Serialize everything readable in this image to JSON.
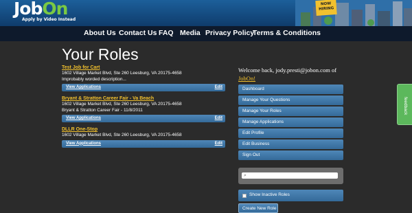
{
  "header": {
    "logo_text_a": "Job",
    "logo_text_b": "On",
    "logo_tagline": "Apply by Video Instead",
    "hiring_badge": "NOW HIRING"
  },
  "nav": {
    "items": [
      "About Us",
      "Contact Us",
      "FAQ",
      "Media",
      "Privacy Policy",
      "Terms & Conditions"
    ]
  },
  "main": {
    "title": "Your Roles",
    "roles": [
      {
        "name": "Test Job for Cart",
        "lines": [
          "1602 Village Market Blvd, Ste 260 Leesburg, VA 20175-4658",
          "Improbably worded description..."
        ],
        "view_label": "View Applications",
        "edit_label": "Edit"
      },
      {
        "name": "Bryant & Stratton Career Fair - Va Beach",
        "lines": [
          "1602 Village Market Blvd, Ste 260 Leesburg, VA 20175-4658",
          "Bryant & Stratton Career Fair - 11/8/2011"
        ],
        "view_label": "View Applications",
        "edit_label": "Edit"
      },
      {
        "name": "DLLR One-Stop",
        "lines": [
          "1602 Village Market Blvd, Ste 260 Leesburg, VA 20175-4658"
        ],
        "view_label": "View Applications",
        "edit_label": "Edit"
      }
    ]
  },
  "sidebar": {
    "welcome_text": "Welcome back, jody.presti@jobon.com of",
    "welcome_link": "JobOn!",
    "menu": [
      "Dashboard",
      "Manage Your Questions",
      "Manage Your Roles",
      "Manage Applications",
      "Edit Profile",
      "Edit Business",
      "Sign Out"
    ],
    "search_placeholder": "",
    "show_inactive_label": "Show Inactive Roles",
    "show_inactive_checked": false,
    "create_label": "Create New Role"
  },
  "feedback": {
    "label": "feedback"
  },
  "colors": {
    "header_blue": "#1c5f9a",
    "nav_dark": "#0e1a2c",
    "background": "#2b2b2b",
    "button_blue": "#4f87b8",
    "link_yellow": "#f2c12e",
    "logo_green": "#7ac943",
    "feedback_green": "#5cb85c"
  }
}
